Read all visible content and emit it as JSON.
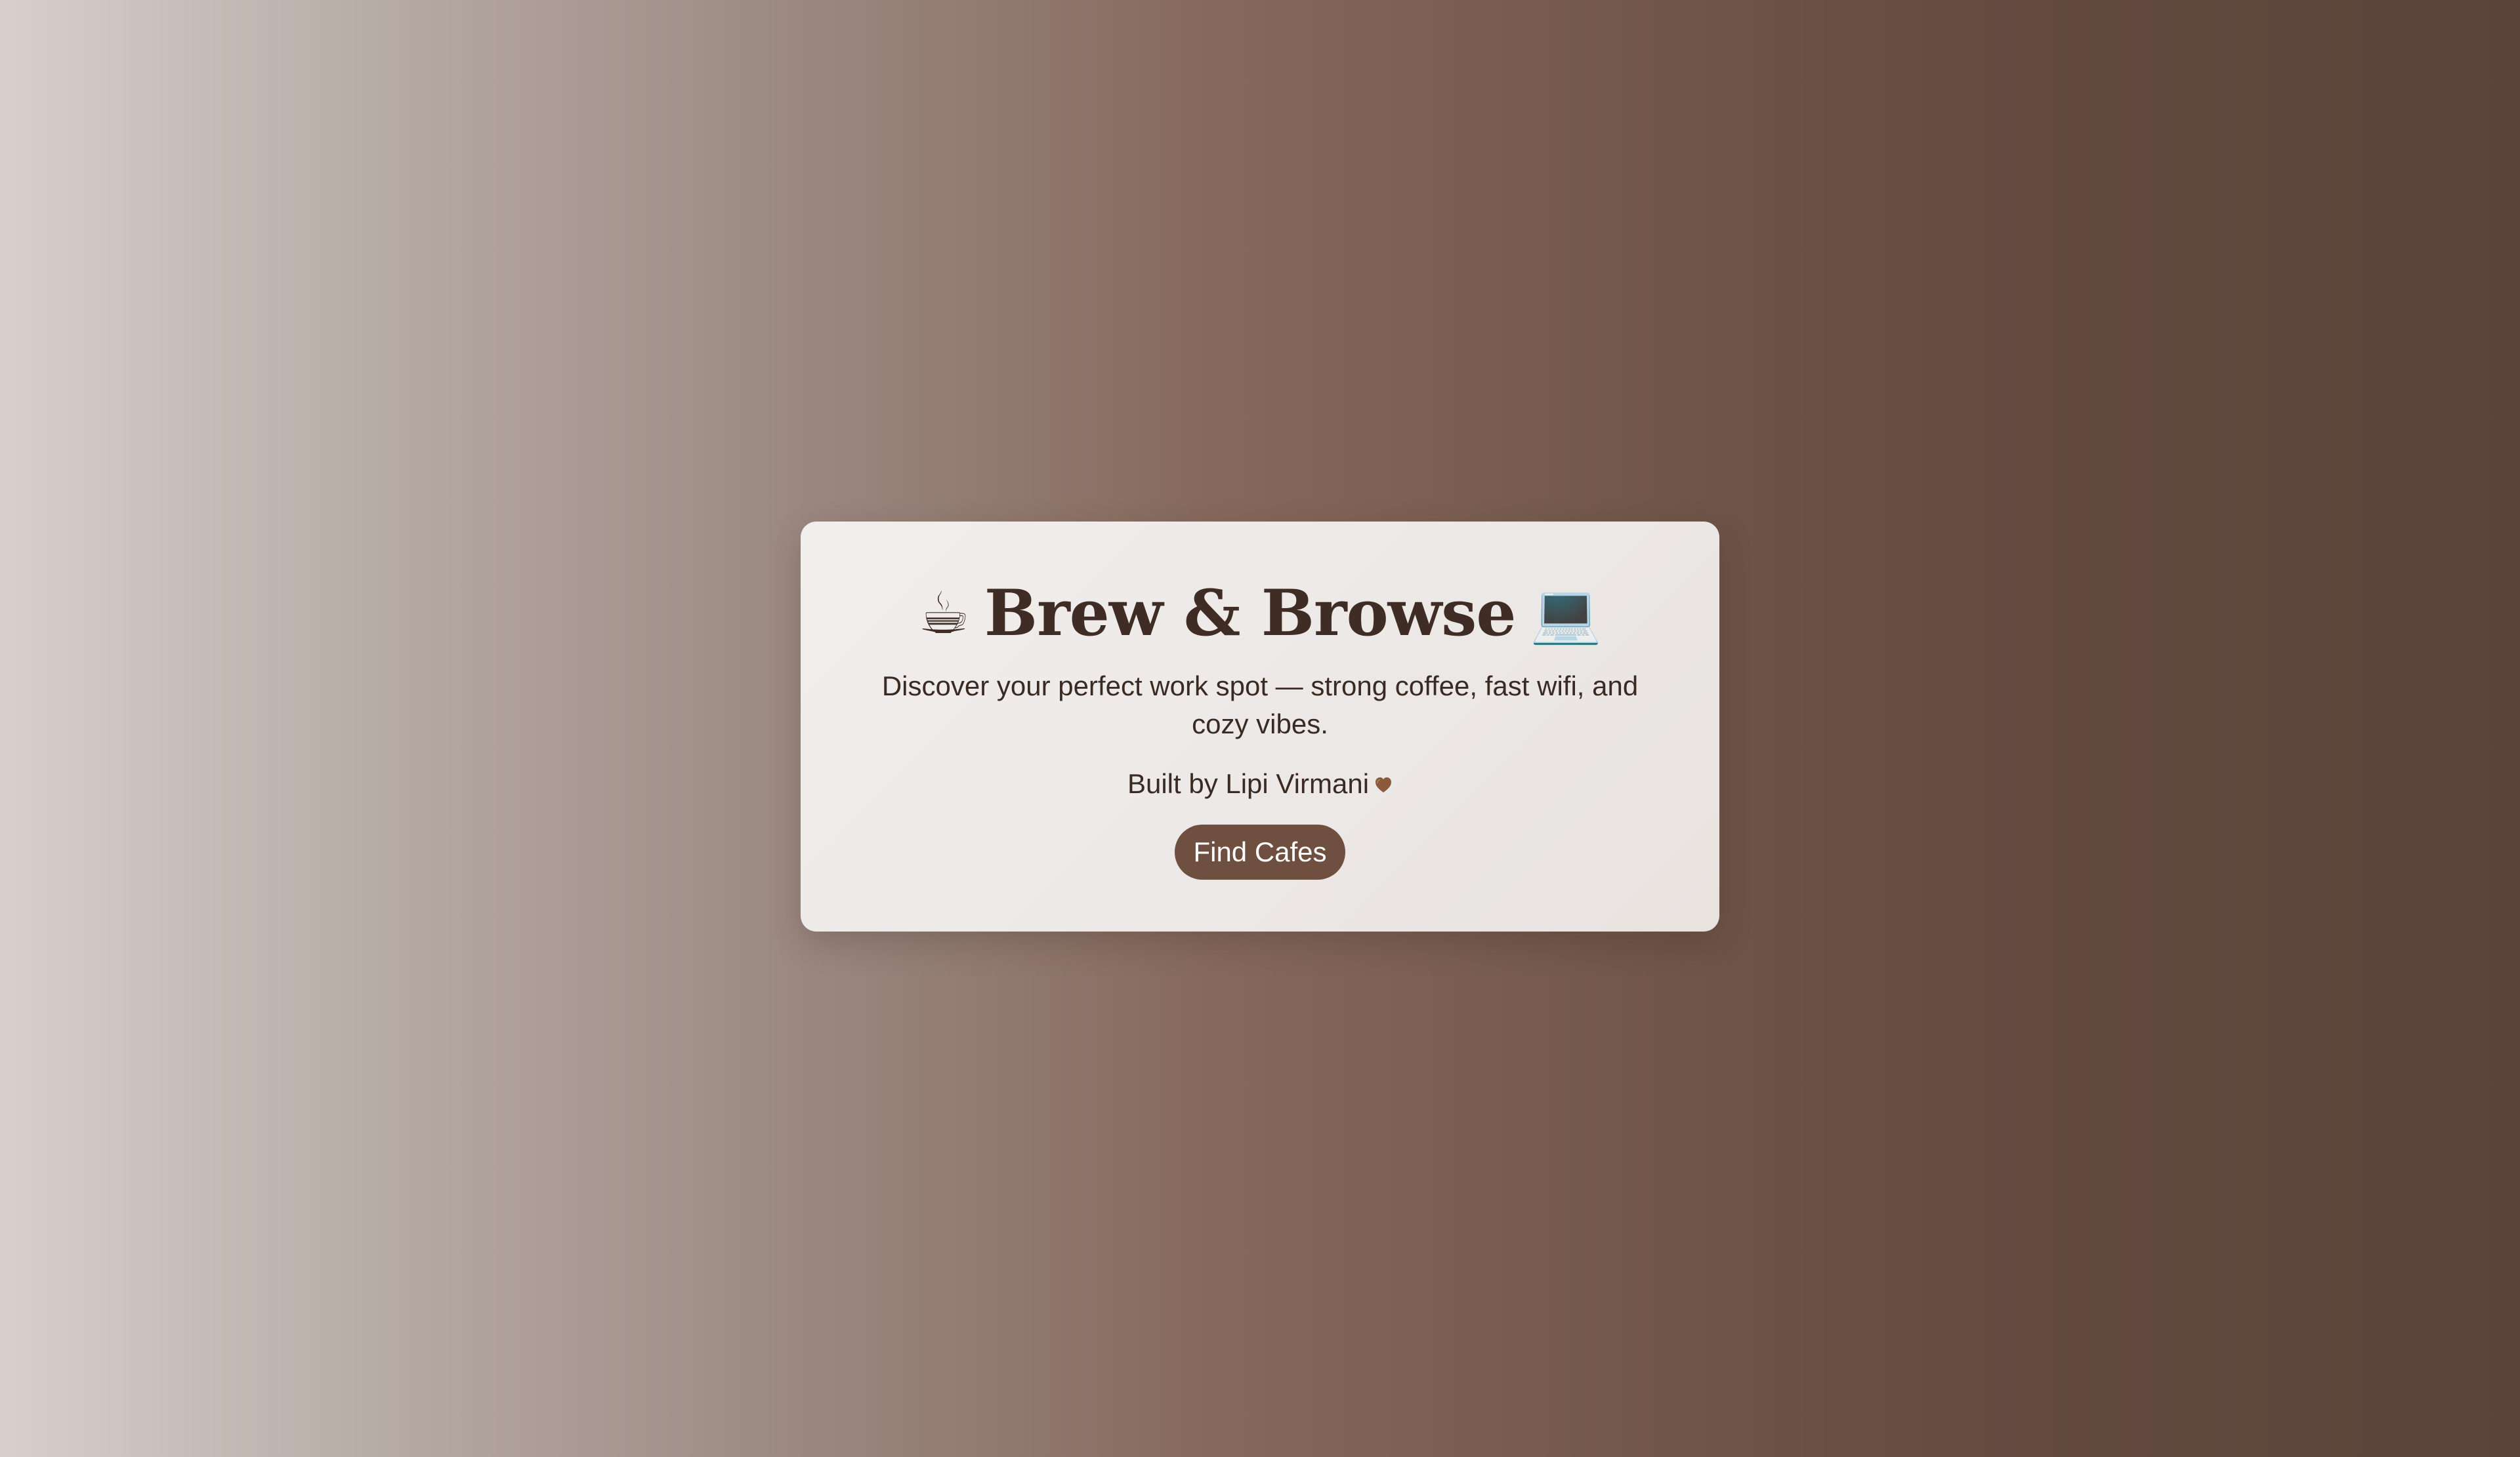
{
  "hero": {
    "title": "Brew & Browse",
    "title_left_icon": "coffee-cup-icon",
    "title_left_symbol": "☕",
    "title_right_icon": "laptop-icon",
    "title_right_symbol": "💻",
    "subtitle": "Discover your perfect work spot — strong coffee, fast wifi, and cozy vibes.",
    "credit": "Built by Lipi Virmani",
    "credit_icon": "brown-heart-icon",
    "cta_label": "Find Cafes"
  },
  "colors": {
    "primary": "#6f4f3f",
    "text": "#3f2c25",
    "card_background": "#eeeae8"
  }
}
